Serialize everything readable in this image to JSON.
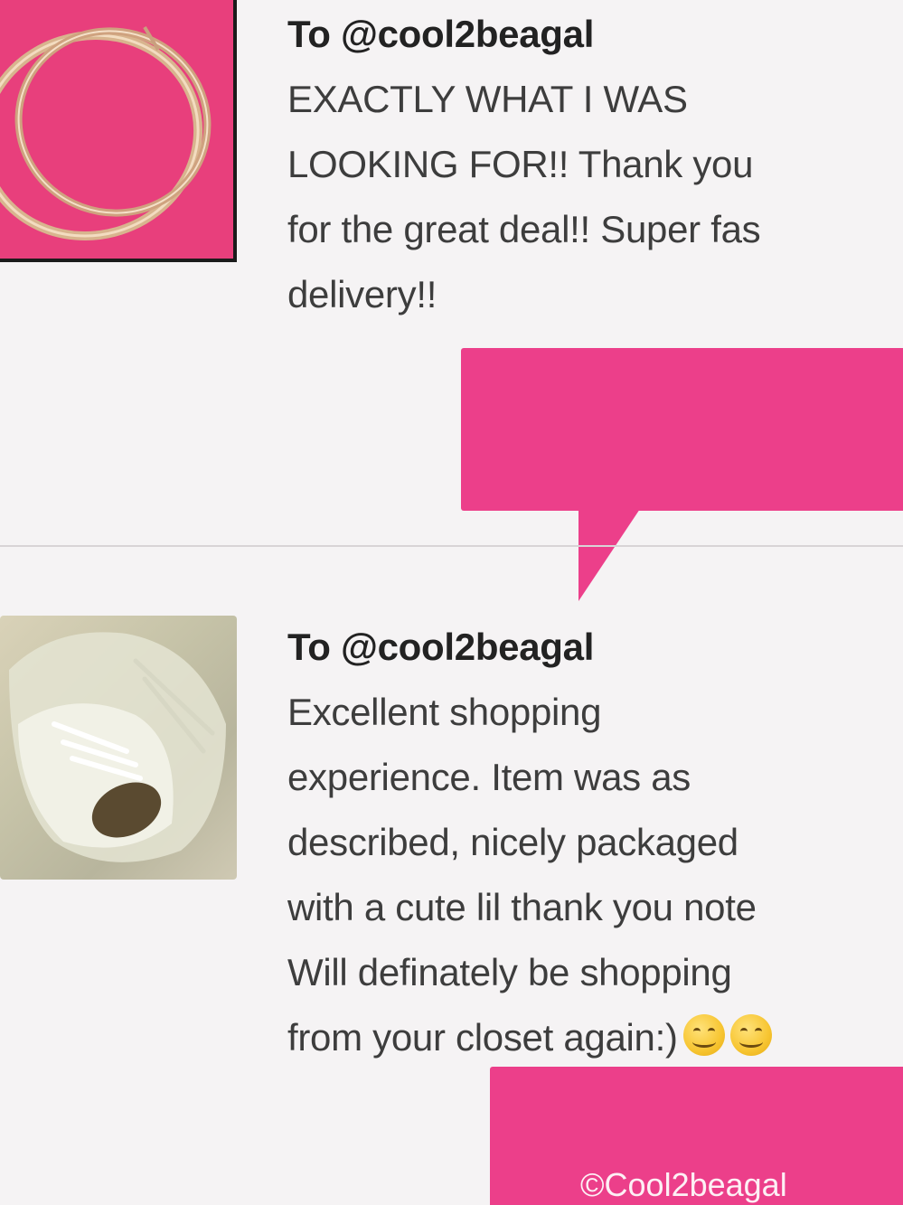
{
  "reviews": [
    {
      "to": "To @cool2beagal",
      "lines": [
        "EXACTLY WHAT I WAS",
        "LOOKING FOR!! Thank you",
        "for the great deal!! Super fas",
        "delivery!!"
      ],
      "thumbnail_icon": "earrings-thumbnail"
    },
    {
      "to": "To @cool2beagal",
      "lines": [
        "Excellent shopping",
        "experience. Item was as",
        "described, nicely packaged",
        "with a cute lil thank you note",
        "Will definately be shopping",
        "from your closet again:)"
      ],
      "thumbnail_icon": "sneakers-thumbnail"
    }
  ],
  "watermark": "©Cool2beagal",
  "colors": {
    "bubble_pink": "#ec3f8a",
    "earrings_bg": "#e83f7c",
    "text": "#3d3d3d"
  }
}
